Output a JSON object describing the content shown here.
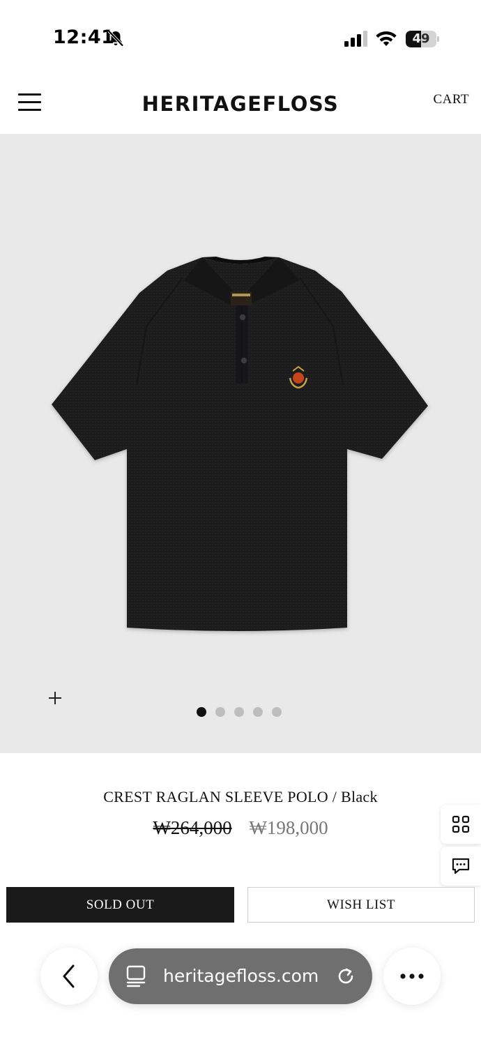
{
  "status_bar": {
    "time": "12:41",
    "battery_percent": 49,
    "battery_label": "49",
    "icons": [
      "bell-slash-icon",
      "cellular-signal-icon",
      "wifi-icon",
      "battery-icon"
    ]
  },
  "header": {
    "menu_icon": "hamburger-icon",
    "logo": "HERITAGEFLOSS",
    "cart_label": "CART"
  },
  "gallery": {
    "image_subject": "black knit polo shirt with crest emblem",
    "zoom_icon": "plus-icon",
    "slide_count": 5,
    "active_slide": 1
  },
  "product": {
    "name": "CREST RAGLAN SLEEVE POLO / Black",
    "original_price": "₩264,000",
    "sale_price": "₩198,000"
  },
  "side_buttons": {
    "grid_icon": "grid-icon",
    "chat_icon": "chat-icon"
  },
  "actions": {
    "sold_out_label": "SOLD OUT",
    "wishlist_label": "WISH LIST"
  },
  "browser": {
    "url": "heritagefloss.com",
    "back_icon": "chevron-left-icon",
    "tabs_icon": "tabs-icon",
    "reload_icon": "reload-icon",
    "more_icon": "ellipsis-icon"
  },
  "colors": {
    "gallery_bg": "#e9e9e9",
    "shirt": "#1b1b1c",
    "sold_out_bg": "#1a1a1a",
    "sale_price": "#777777",
    "url_pill": "#6f6f6f"
  }
}
